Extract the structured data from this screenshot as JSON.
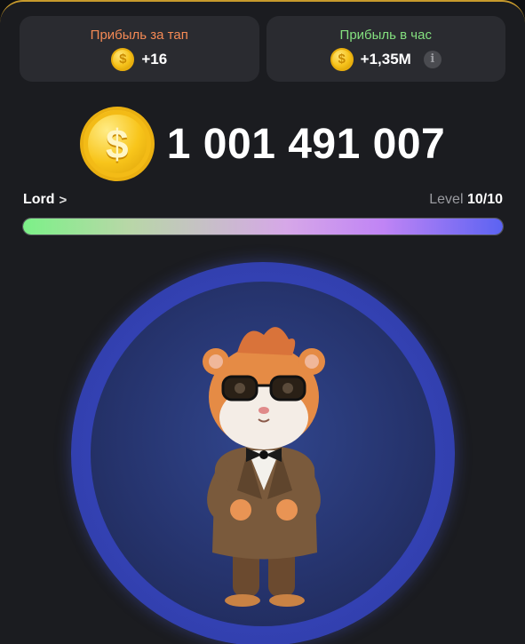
{
  "stats": {
    "tap_label": "Прибыль за тап",
    "tap_value": "+16",
    "hour_label": "Прибыль в час",
    "hour_value": "+1,35M",
    "info_icon": "i"
  },
  "coin_symbol": "$",
  "balance": "1 001 491 007",
  "rank": {
    "name": "Lord",
    "chevron": ">"
  },
  "level": {
    "label": "Level",
    "value": "10/10",
    "progress": 1.0
  },
  "colors": {
    "tap_label": "#f58a55",
    "hour_label": "#84e07f",
    "coin": "#f6c21a",
    "progress_start": "#7cf188",
    "progress_end": "#5b63f2",
    "circle": "#3443b8"
  },
  "character": {
    "icon": "hamster-character"
  }
}
